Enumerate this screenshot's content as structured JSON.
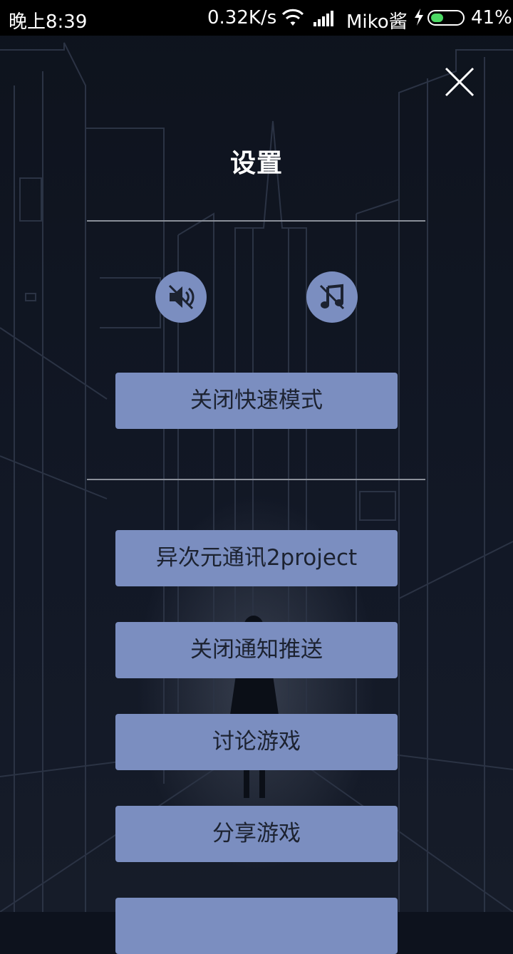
{
  "status_bar": {
    "time": "晚上8:39",
    "net_speed": "0.32K/s",
    "carrier": "Miko酱",
    "battery": "41%",
    "battery_level": 0.41,
    "icons": [
      "wifi-icon",
      "signal-icon",
      "charging-bolt-icon",
      "battery-icon"
    ]
  },
  "page": {
    "title": "设置",
    "close_icon": "close-icon"
  },
  "toggles": {
    "sound": {
      "icon": "sound-muted-icon",
      "state": "off"
    },
    "music": {
      "icon": "music-muted-icon",
      "state": "off"
    }
  },
  "buttons": {
    "fast_mode": "关闭快速模式",
    "project": "异次元通讯2project",
    "notifications": "关闭通知推送",
    "discuss": "讨论游戏",
    "share": "分享游戏",
    "partial": ""
  },
  "colors": {
    "button_bg": "#7b8ec0",
    "button_text": "#1c2230",
    "background": "#0d121d"
  }
}
